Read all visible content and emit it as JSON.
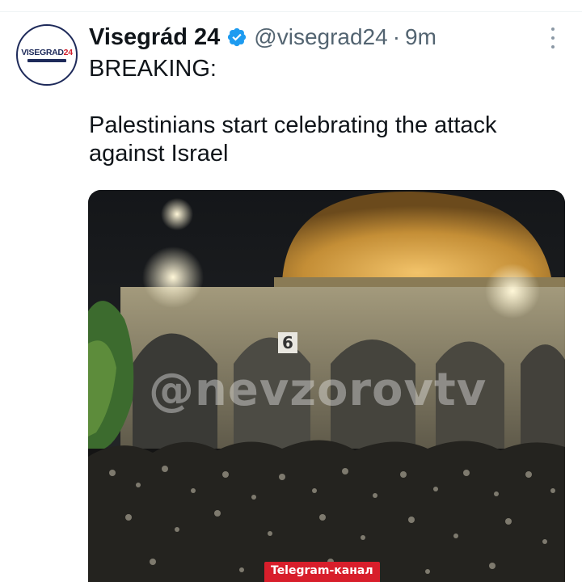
{
  "tweet": {
    "avatar": {
      "brand": "VISEGRAD",
      "brand_accent": "24"
    },
    "author_name": "Visegrád 24",
    "verified_icon": "verified-badge-icon",
    "handle": "@visegrad24",
    "separator": "·",
    "timestamp": "9m",
    "more_icon": "more-options-icon",
    "text_lines": [
      "BREAKING:",
      "Palestinians start celebrating the attack",
      "against Israel"
    ]
  },
  "media": {
    "kind": "video-still",
    "watermark": "@nevzorovtv",
    "building_number": "6",
    "telegram_badge": "Telegram-канал"
  },
  "colors": {
    "verified": "#1d9bf0",
    "secondary_text": "#536471",
    "badge_red": "#d81e2b"
  }
}
